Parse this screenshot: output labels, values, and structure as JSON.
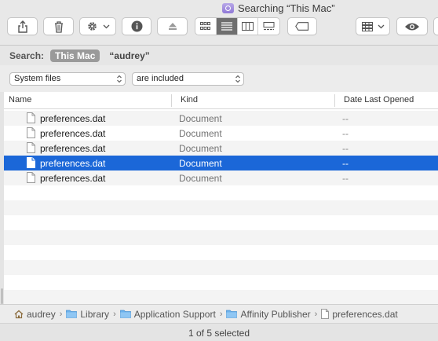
{
  "window": {
    "title": "Searching “This Mac”"
  },
  "toolbar": {
    "share": "share-icon",
    "trash": "trash-icon",
    "action": "gear-icon",
    "info": "info-icon",
    "eject": "eject-icon",
    "views": [
      "icon-view",
      "list-view",
      "column-view",
      "gallery-view"
    ],
    "active_view": "list-view",
    "tag": "tag-icon",
    "group": "group-icon",
    "quicklook": "eye-icon"
  },
  "search": {
    "label": "Search:",
    "scope_active": "This Mac",
    "scope_other": "“audrey”"
  },
  "criteria": {
    "attribute": "System files",
    "condition": "are included"
  },
  "table": {
    "columns": [
      "Name",
      "Kind",
      "Date Last Opened"
    ],
    "rows": [
      {
        "name": "preferences.dat",
        "kind": "Document",
        "date": "--",
        "selected": false
      },
      {
        "name": "preferences.dat",
        "kind": "Document",
        "date": "--",
        "selected": false
      },
      {
        "name": "preferences.dat",
        "kind": "Document",
        "date": "--",
        "selected": false
      },
      {
        "name": "preferences.dat",
        "kind": "Document",
        "date": "--",
        "selected": true
      },
      {
        "name": "preferences.dat",
        "kind": "Document",
        "date": "--",
        "selected": false
      }
    ]
  },
  "path": [
    {
      "label": "audrey",
      "icon": "home-icon"
    },
    {
      "label": "Library",
      "icon": "folder-icon"
    },
    {
      "label": "Application Support",
      "icon": "folder-icon"
    },
    {
      "label": "Affinity Publisher",
      "icon": "folder-icon"
    },
    {
      "label": "preferences.dat",
      "icon": "document-icon"
    }
  ],
  "status": {
    "text": "1 of 5 selected"
  },
  "colors": {
    "selection": "#1b67d8",
    "scope_badge": "#9a9a9a"
  }
}
